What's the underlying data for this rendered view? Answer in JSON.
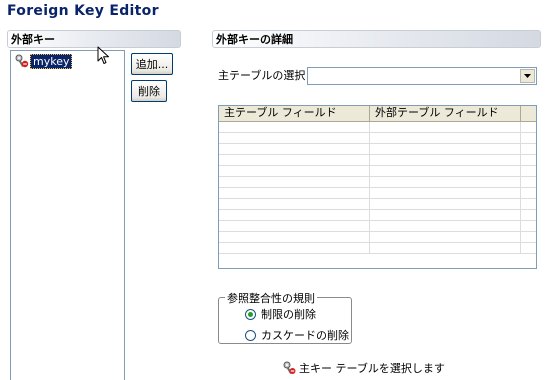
{
  "window": {
    "title": "Foreign Key Editor"
  },
  "foreign_keys_panel": {
    "header": "外部キー",
    "items": [
      {
        "label": "mykey",
        "icon": "key-icon",
        "selected": true
      }
    ],
    "add_button": "追加...",
    "delete_button": "削除"
  },
  "details_panel": {
    "header": "外部キーの詳細",
    "main_table_label": "主テーブルの選択",
    "main_table_value": "",
    "grid": {
      "columns": [
        "主テーブル フィールド",
        "外部テーブル フィールド"
      ],
      "rows": [
        [
          "",
          ""
        ],
        [
          "",
          ""
        ],
        [
          "",
          ""
        ],
        [
          "",
          ""
        ],
        [
          "",
          ""
        ],
        [
          "",
          ""
        ],
        [
          "",
          ""
        ],
        [
          "",
          ""
        ],
        [
          "",
          ""
        ],
        [
          "",
          ""
        ],
        [
          "",
          ""
        ],
        [
          "",
          ""
        ]
      ]
    },
    "integrity": {
      "legend": "参照整合性の規則",
      "options": [
        {
          "label": "制限の削除",
          "checked": true
        },
        {
          "label": "カスケードの削除",
          "checked": false
        }
      ]
    },
    "status_message": "主キー テーブルを選択します"
  },
  "colors": {
    "title": "#0a246a",
    "selection": "#0a246a",
    "radio_dot": "#21a121"
  }
}
